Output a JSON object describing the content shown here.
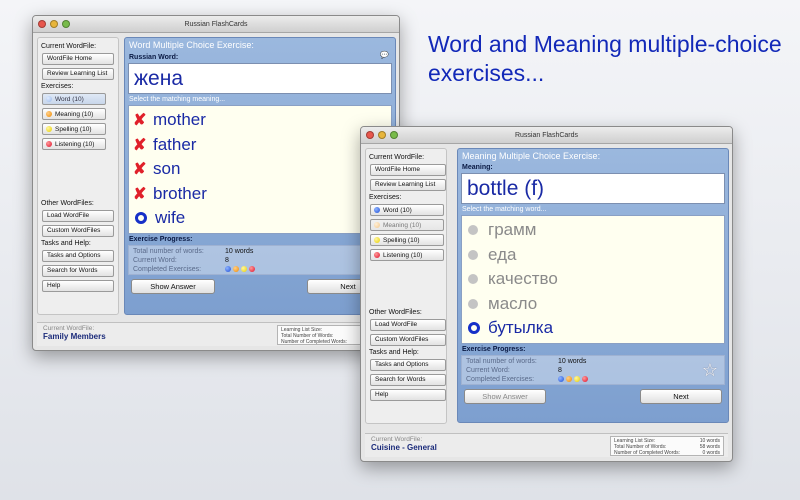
{
  "caption": {
    "line1": "Word and Meaning multiple-choice",
    "line2": "exercises..."
  },
  "window1": {
    "title": "Russian FlashCards",
    "sidebar": {
      "current_wordfile_heading": "Current WordFile:",
      "wordfile_home": "WordFile Home",
      "review_learning_list": "Review Learning List",
      "exercises_heading": "Exercises:",
      "exercises": [
        {
          "label": "Word (10)",
          "dot": "paleblue",
          "state": "active"
        },
        {
          "label": "Meaning (10)",
          "dot": "orange",
          "state": "normal"
        },
        {
          "label": "Spelling (10)",
          "dot": "yellow",
          "state": "normal"
        },
        {
          "label": "Listening (10)",
          "dot": "red",
          "state": "normal"
        }
      ],
      "other_wordfiles_heading": "Other WordFiles:",
      "load_wordfile": "Load WordFile",
      "custom_wordfiles": "Custom WordFiles",
      "tasks_heading": "Tasks and Help:",
      "tasks_and_options": "Tasks and Options",
      "search_for_words": "Search for Words",
      "help": "Help"
    },
    "main": {
      "title": "Word Multiple Choice Exercise:",
      "prompt_label": "Russian Word:",
      "prompt_word": "жена",
      "select_label": "Select the matching meaning...",
      "choices": [
        {
          "text": "mother",
          "mark": "x"
        },
        {
          "text": "father",
          "mark": "x"
        },
        {
          "text": "son",
          "mark": "x"
        },
        {
          "text": "brother",
          "mark": "x"
        },
        {
          "text": "wife",
          "mark": "o"
        }
      ],
      "progress_label": "Exercise Progress:",
      "total_label": "Total number of words:",
      "total_value": "10 words",
      "current_label": "Current Word:",
      "current_value": "8",
      "completed_label": "Completed Exercises:",
      "show_answer": "Show Answer",
      "next": "Next"
    },
    "status": {
      "current_wordfile_label": "Current WordFile:",
      "current_wordfile": "Family Members",
      "learning_list_size_label": "Learning List Size:",
      "total_words_label": "Total Number of Words:",
      "completed_words_label": "Number of Completed Words:"
    }
  },
  "window2": {
    "title": "Russian FlashCards",
    "sidebar": {
      "current_wordfile_heading": "Current WordFile:",
      "wordfile_home": "WordFile Home",
      "review_learning_list": "Review Learning List",
      "exercises_heading": "Exercises:",
      "exercises": [
        {
          "label": "Word (10)",
          "dot": "blue",
          "state": "normal"
        },
        {
          "label": "Meaning (10)",
          "dot": "pale",
          "state": "muted"
        },
        {
          "label": "Spelling (10)",
          "dot": "yellow",
          "state": "normal"
        },
        {
          "label": "Listening (10)",
          "dot": "red",
          "state": "normal"
        }
      ],
      "other_wordfiles_heading": "Other WordFiles:",
      "load_wordfile": "Load WordFile",
      "custom_wordfiles": "Custom WordFiles",
      "tasks_heading": "Tasks and Help:",
      "tasks_and_options": "Tasks and Options",
      "search_for_words": "Search for Words",
      "help": "Help"
    },
    "main": {
      "title": "Meaning Multiple Choice Exercise:",
      "prompt_label": "Meaning:",
      "prompt_word": "bottle (f)",
      "select_label": "Select the matching word...",
      "choices": [
        {
          "text": "грамм",
          "mark": "gray"
        },
        {
          "text": "еда",
          "mark": "gray"
        },
        {
          "text": "качество",
          "mark": "gray"
        },
        {
          "text": "масло",
          "mark": "gray"
        },
        {
          "text": "бутылка",
          "mark": "o"
        }
      ],
      "progress_label": "Exercise Progress:",
      "total_label": "Total number of words:",
      "total_value": "10 words",
      "current_label": "Current Word:",
      "current_value": "8",
      "completed_label": "Completed Exercises:",
      "show_answer": "Show Answer",
      "next": "Next"
    },
    "status": {
      "current_wordfile_label": "Current WordFile:",
      "current_wordfile": "Cuisine - General",
      "learning_list_size_label": "Learning List Size:",
      "learning_list_size_value": "10 words",
      "total_words_label": "Total Number of Words:",
      "total_words_value": "58 words",
      "completed_words_label": "Number of Completed Words:",
      "completed_words_value": "0 words"
    }
  },
  "completed_dots": [
    "blue",
    "orange",
    "yellow",
    "red"
  ]
}
